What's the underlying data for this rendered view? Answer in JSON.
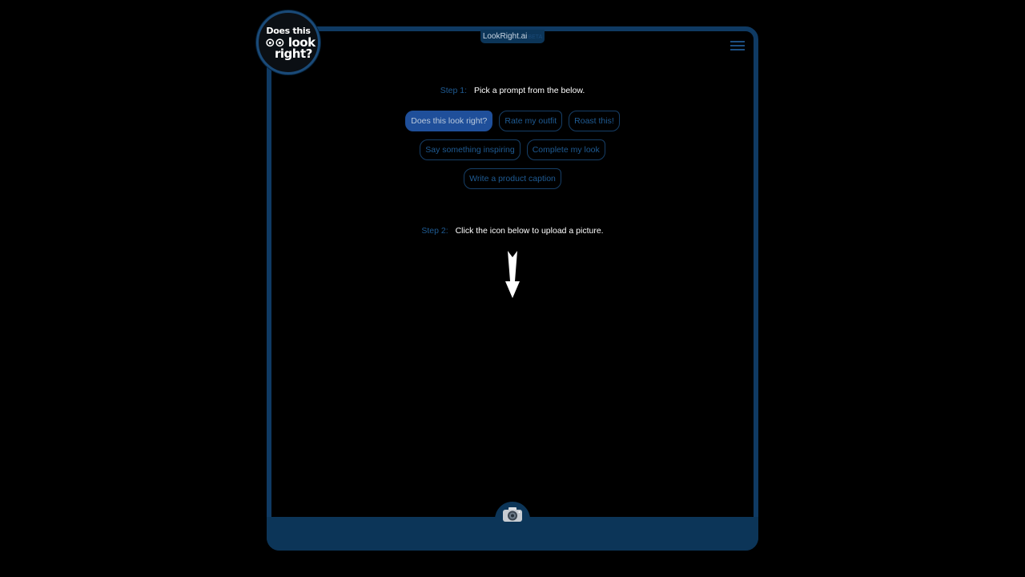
{
  "app": {
    "title": "LookRight.ai",
    "badge": "BETA",
    "logo": {
      "line1": "Does this",
      "line2": "⊙⊙ look",
      "line3": "right?"
    }
  },
  "colors": {
    "brand": "#0c3558",
    "accent": "#1f4f9a",
    "muted_text": "#1f5b93"
  },
  "step1": {
    "label": "Step 1:",
    "text": "Pick a prompt from the below."
  },
  "prompts": {
    "row1": [
      {
        "label": "Does this look right?",
        "selected": true
      },
      {
        "label": "Rate my outfit",
        "selected": false
      },
      {
        "label": "Roast this!",
        "selected": false
      }
    ],
    "row2": [
      {
        "label": "Say something inspiring",
        "selected": false
      },
      {
        "label": "Complete my look",
        "selected": false
      }
    ],
    "row3": [
      {
        "label": "Write a product caption",
        "selected": false
      }
    ]
  },
  "step2": {
    "label": "Step 2:",
    "text": "Click the icon below to upload a picture."
  },
  "icons": {
    "menu": "hamburger-menu-icon",
    "arrow": "arrow-down-icon",
    "camera": "camera-icon"
  }
}
